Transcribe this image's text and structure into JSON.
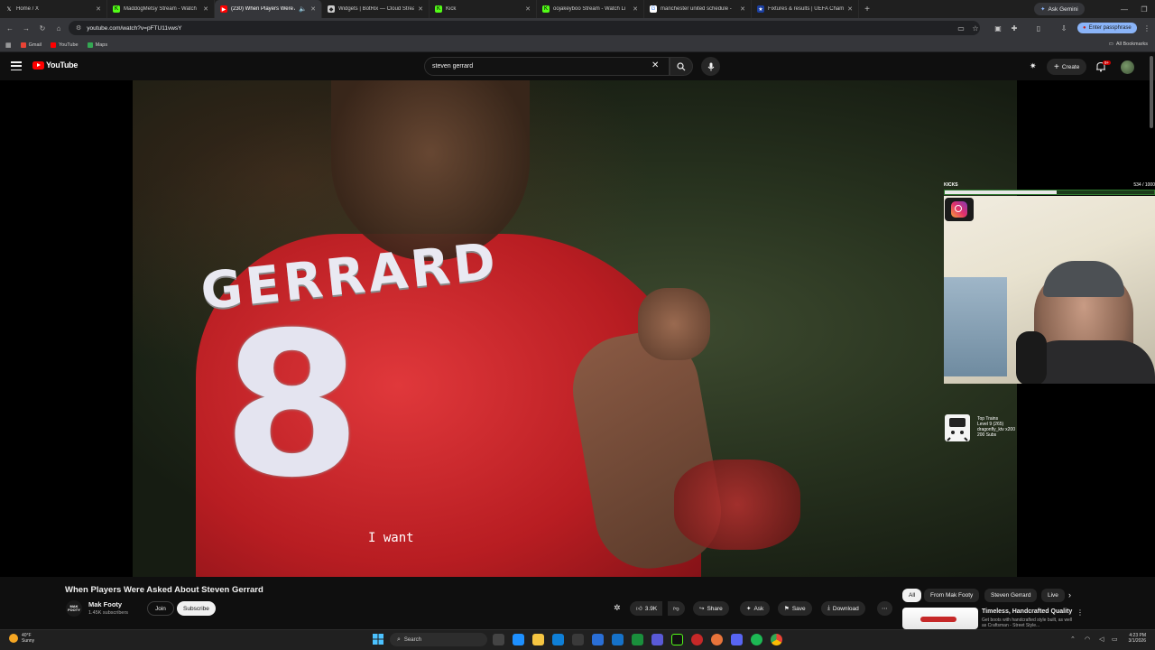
{
  "browser": {
    "tabs": [
      {
        "title": "Home / X",
        "icon": "x-logo-icon",
        "color": "#ffffff"
      },
      {
        "title": "MaddogMetsy Stream - Watch",
        "icon": "kick-icon",
        "color": "#53fc18"
      },
      {
        "title": "(230) When Players Were A",
        "icon": "youtube-icon",
        "color": "#ff0000"
      },
      {
        "title": "Widgets | BotRix — Cloud Strea",
        "icon": "botrix-icon",
        "color": "#cccccc"
      },
      {
        "title": "Kick",
        "icon": "kick-icon",
        "color": "#53fc18"
      },
      {
        "title": "oojakeyboo Stream - Watch Li",
        "icon": "kick-icon",
        "color": "#53fc18"
      },
      {
        "title": "manchester united schedule -",
        "icon": "google-icon",
        "color": "#4285f4"
      },
      {
        "title": "Fixtures & results | UEFA Champ",
        "icon": "uefa-icon",
        "color": "#1b3fa0"
      }
    ],
    "active_tab_index": 2,
    "gemini_label": "Ask Gemini",
    "url": "youtube.com/watch?v=pFTU11vwsY",
    "passphrase_label": "Enter passphrase",
    "bookmarks": [
      {
        "label": "Gmail",
        "color": "#ea4335"
      },
      {
        "label": "YouTube",
        "color": "#ff0000"
      },
      {
        "label": "Maps",
        "color": "#34a853"
      }
    ],
    "all_bookmarks_label": "All Bookmarks"
  },
  "youtube": {
    "logo_text": "YouTube",
    "search_value": "steven gerrard",
    "create_label": "Create",
    "notification_count": "9+",
    "video": {
      "jersey_name": "GERRARD",
      "jersey_number": "8",
      "caption": "I want"
    },
    "overlay": {
      "kicks_label": "KICKS",
      "kicks_count": "534 / 1000",
      "kicks_progress": 0.534,
      "top_train_lines": [
        "Top Trains",
        "Level 9 (265)",
        "dragonfly_ktv x200",
        "200 Subs"
      ]
    },
    "details": {
      "title": "When Players Were Asked About Steven Gerrard",
      "channel_avatar_text": "MAK FOOTY",
      "channel_name": "Mak Footy",
      "subscribers": "1.45K subscribers",
      "join_label": "Join",
      "subscribe_label": "Subscribe",
      "like_count": "3.9K",
      "share_label": "Share",
      "ask_label": "Ask",
      "save_label": "Save",
      "download_label": "Download"
    },
    "chips": [
      "All",
      "From Mak Footy",
      "Steven Gerrard",
      "Live"
    ],
    "recommendation": {
      "title": "Timeless, Handcrafted Quality",
      "subtitle": "Get boots with handcrafted style built, as well as Craftsman - Street Style..."
    }
  },
  "taskbar": {
    "weather_temp": "40°F",
    "weather_desc": "Sunny",
    "search_placeholder": "Search",
    "time": "4:23 PM",
    "date": "3/1/2026"
  }
}
